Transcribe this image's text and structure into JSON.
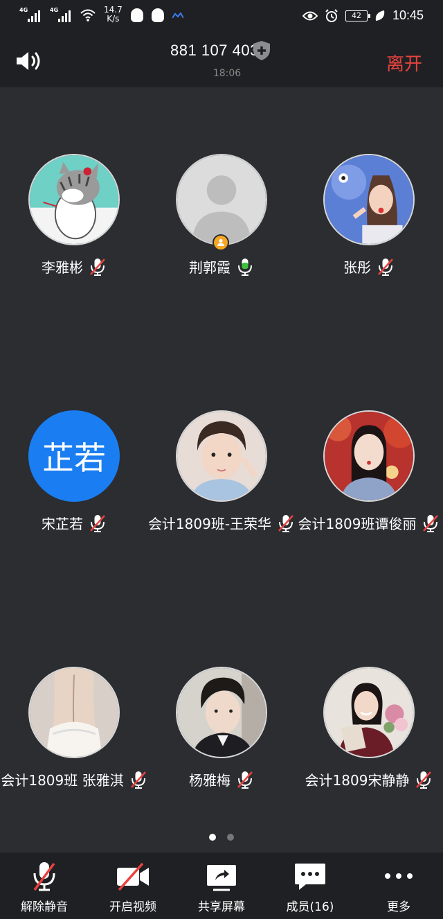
{
  "status_bar": {
    "network_1": "4G",
    "network_2": "4G",
    "speed_value": "14.7",
    "speed_unit": "K/s",
    "battery": "42",
    "time": "10:45"
  },
  "header": {
    "meeting_id": "881 107 403",
    "elapsed": "18:06",
    "leave_label": "离开"
  },
  "participants": [
    {
      "name": "李雅彬",
      "mic": "muted"
    },
    {
      "name": "荆郭霞",
      "mic": "active",
      "role": "host"
    },
    {
      "name": "张彤",
      "mic": "muted"
    },
    {
      "name": "宋芷若",
      "mic": "muted",
      "initials": "芷若"
    },
    {
      "name": "会计1809班-王荣华",
      "mic": "muted"
    },
    {
      "name": "会计1809班谭俊丽",
      "mic": "muted"
    },
    {
      "name": "会计1809班 张雅淇",
      "mic": "muted"
    },
    {
      "name": "杨雅梅",
      "mic": "muted"
    },
    {
      "name": "会计1809宋静静",
      "mic": "muted"
    }
  ],
  "pagination": {
    "current": 1,
    "total": 2
  },
  "toolbar": {
    "unmute": "解除静音",
    "start_video": "开启视频",
    "share_screen": "共享屏幕",
    "members": "成员(16)",
    "more": "更多"
  },
  "colors": {
    "background": "#2b2d31",
    "bar": "#1f2023",
    "leave": "#e8433f",
    "mic_active": "#3cc23c",
    "mute_slash": "#e8433f",
    "text_avatar": "#1a7ef2",
    "host_badge": "#f5a623"
  }
}
